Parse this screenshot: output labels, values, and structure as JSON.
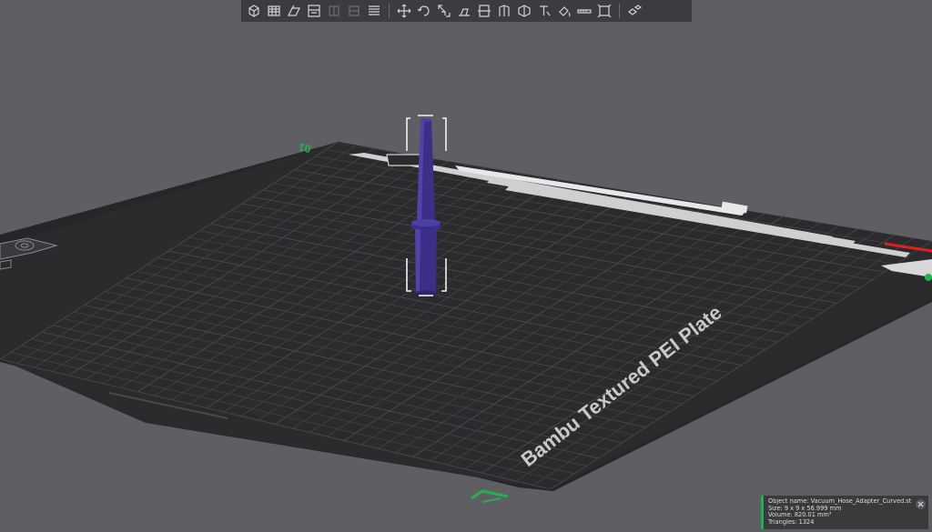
{
  "toolbar": {
    "groups": [
      [
        "add-object-icon",
        "grid-arrange-icon",
        "orient-icon",
        "split-layout-icon",
        "disabled-layout-icon",
        "disabled-list-icon",
        "list-layers-icon"
      ],
      [
        "move-icon",
        "rotate-icon",
        "scale-icon",
        "lay-on-face-icon",
        "cut-icon",
        "support-paint-icon",
        "seam-paint-icon",
        "text-emboss-icon",
        "color-paint-icon",
        "measure-icon",
        "assembly-icon"
      ],
      [
        "explode-view-icon"
      ]
    ]
  },
  "plate": {
    "label": "Bambu Textured PEI Plate",
    "number": "01"
  },
  "object_info": {
    "name": "Object name: Vacuum_Hose_Adapter_Curved.stl",
    "size": "Size: 9 x 9 x 56.999 mm",
    "volume": "Volume: 820.01 mm³",
    "triangles": "Triangles: 1324"
  },
  "colors": {
    "background": "#5f5f63",
    "plate": "#2b2b2e",
    "model": "#3b2f88",
    "accent": "#1fb34f",
    "axis_x": "#e02020"
  }
}
